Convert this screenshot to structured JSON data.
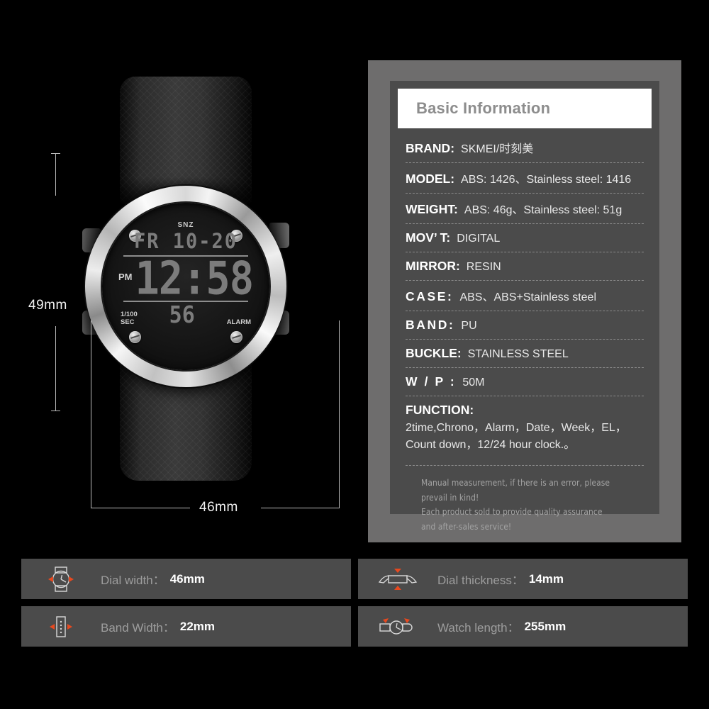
{
  "theme": {
    "background": "#000000",
    "panel_outer": "#6e6d6d",
    "panel_inner": "#4b4b4b",
    "title_bar": "#ffffff",
    "accent_orange": "#e8491f",
    "label_gray": "#9d9d9d"
  },
  "product": {
    "watch": {
      "lcd": {
        "snz": "SNZ",
        "date": "FR 10-20",
        "ampm": "PM",
        "time": "12:58",
        "sub_left_line1": "1/100",
        "sub_left_line2": "SEC",
        "seconds": "56",
        "sub_right": "ALARM"
      }
    },
    "dimensions": {
      "height_label": "49mm",
      "width_label": "46mm"
    }
  },
  "spec_panel": {
    "title": "Basic Information",
    "rows": [
      {
        "key": "BRAND:",
        "value": "SKMEI/时刻美",
        "spacing": "normal"
      },
      {
        "key": "MODEL:",
        "value": "ABS: 1426、Stainless steel: 1416",
        "spacing": "normal"
      },
      {
        "key": "WEIGHT:",
        "value": "ABS: 46g、Stainless steel: 51g",
        "spacing": "normal"
      },
      {
        "key": "MOV’ T:",
        "value": "DIGITAL",
        "spacing": "normal"
      },
      {
        "key": "MIRROR:",
        "value": "RESIN",
        "spacing": "normal"
      },
      {
        "key": "CASE:",
        "value": "ABS、ABS+Stainless steel",
        "spacing": "wide1"
      },
      {
        "key": "BAND:",
        "value": "PU",
        "spacing": "wide1"
      },
      {
        "key": "BUCKLE:",
        "value": "STAINLESS STEEL",
        "spacing": "normal"
      },
      {
        "key": "W / P :",
        "value": "50M",
        "spacing": "wide1"
      },
      {
        "key": "FUNCTION:",
        "value": "2time,Chrono，Alarm，Date，Week，EL，Count down，12/24 hour clock.。",
        "spacing": "normal"
      }
    ],
    "notes": [
      "Manual measurement, if there is an error, please prevail in kind!",
      "Each product sold to provide quality assurance and after-sales service!"
    ]
  },
  "bottom_bars": [
    {
      "icon": "watch-dial-icon",
      "label": "Dial width：",
      "value": "46mm"
    },
    {
      "icon": "watch-thickness-icon",
      "label": "Dial thickness：",
      "value": "14mm"
    },
    {
      "icon": "watch-band-icon",
      "label": "Band Width：",
      "value": "22mm"
    },
    {
      "icon": "watch-length-icon",
      "label": "Watch length：",
      "value": "255mm"
    }
  ]
}
